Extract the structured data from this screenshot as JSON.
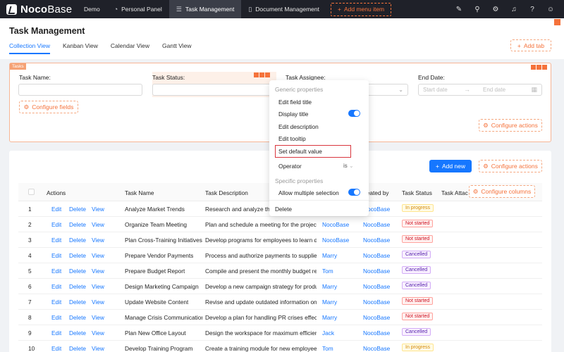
{
  "topbar": {
    "brand_bold": "Noco",
    "brand_regular": "Base",
    "menu": [
      {
        "label": "Demo",
        "icon": "none"
      },
      {
        "label": "Personal Panel",
        "icon": "pie-chart-icon"
      },
      {
        "label": "Task Management",
        "icon": "list-icon",
        "active": true
      },
      {
        "label": "Document Management",
        "icon": "file-icon"
      }
    ],
    "add_menu_label": "Add menu item",
    "right_icons": [
      "brush-icon",
      "plugin-icon",
      "settings-icon",
      "bell-icon",
      "help-icon",
      "user-icon"
    ]
  },
  "page": {
    "title": "Task Management",
    "tabs": [
      "Collection View",
      "Kanban View",
      "Calendar View",
      "Gantt View"
    ],
    "add_tab_label": "Add tab"
  },
  "filter": {
    "tag": "Tasks",
    "fields": {
      "name_label": "Task Name:",
      "status_label": "Task Status:",
      "assignee_label": "Task Assignee:",
      "end_date_label": "End Date:"
    },
    "start_date_placeholder": "Start date",
    "end_date_placeholder": "End date",
    "configure_fields_label": "Configure fields",
    "configure_actions_label": "Configure actions"
  },
  "table": {
    "add_new_label": "Add new",
    "configure_actions_label": "Configure actions",
    "configure_columns_label": "Configure columns",
    "headers": {
      "actions": "Actions",
      "task_name": "Task Name",
      "task_description": "Task Description",
      "created_by": "Created by",
      "task_status": "Task Status",
      "task_attach": "Task Attac"
    },
    "action_labels": {
      "edit": "Edit",
      "delete": "Delete",
      "view": "View"
    },
    "rows": [
      {
        "no": "1",
        "name": "Analyze Market Trends",
        "desc": "Research and analyze the l",
        "assignee": "",
        "created": "NocoBase",
        "status": "In progress",
        "status_kind": "progress"
      },
      {
        "no": "2",
        "name": "Organize Team Meeting",
        "desc": "Plan and schedule a meeting for the project ...",
        "assignee": "NocoBase",
        "created": "NocoBase",
        "status": "Not started",
        "status_kind": "notstarted"
      },
      {
        "no": "3",
        "name": "Plan Cross-Training Initiatives",
        "desc": "Develop programs for employees to learn di...",
        "assignee": "NocoBase",
        "created": "NocoBase",
        "status": "Not started",
        "status_kind": "notstarted"
      },
      {
        "no": "4",
        "name": "Prepare Vendor Payments",
        "desc": "Process and authorize payments to suppliers.",
        "assignee": "Marry",
        "created": "NocoBase",
        "status": "Cancelled",
        "status_kind": "cancelled"
      },
      {
        "no": "5",
        "name": "Prepare Budget Report",
        "desc": "Compile and present the monthly budget re...",
        "assignee": "Tom",
        "created": "NocoBase",
        "status": "Cancelled",
        "status_kind": "cancelled"
      },
      {
        "no": "6",
        "name": "Design Marketing Campaign",
        "desc": "Develop a new campaign strategy for produ...",
        "assignee": "Marry",
        "created": "NocoBase",
        "status": "Cancelled",
        "status_kind": "cancelled"
      },
      {
        "no": "7",
        "name": "Update Website Content",
        "desc": "Revise and update outdated information on ...",
        "assignee": "Marry",
        "created": "NocoBase",
        "status": "Not started",
        "status_kind": "notstarted"
      },
      {
        "no": "8",
        "name": "Manage Crisis Communication",
        "desc": "Develop a plan for handling PR crises effecti...",
        "assignee": "Marry",
        "created": "NocoBase",
        "status": "Not started",
        "status_kind": "notstarted"
      },
      {
        "no": "9",
        "name": "Plan New Office Layout",
        "desc": "Design the workspace for maximum efficien...",
        "assignee": "Jack",
        "created": "NocoBase",
        "status": "Cancelled",
        "status_kind": "cancelled"
      },
      {
        "no": "10",
        "name": "Develop Training Program",
        "desc": "Create a training module for new employees.",
        "assignee": "Tom",
        "created": "NocoBase",
        "status": "In progress",
        "status_kind": "progress"
      }
    ]
  },
  "dropdown": {
    "generic_header": "Generic properties",
    "edit_field_title": "Edit field title",
    "display_title": "Display title",
    "edit_description": "Edit description",
    "edit_tooltip": "Edit tooltip",
    "set_default_value": "Set default value",
    "operator": "Operator",
    "operator_value": "is",
    "specific_header": "Specific properties",
    "allow_multiple": "Allow multiple selection",
    "delete": "Delete"
  },
  "colors": {
    "accent": "#1677ff",
    "config_orange": "#f5723b",
    "topbar_bg": "#1f2129"
  }
}
